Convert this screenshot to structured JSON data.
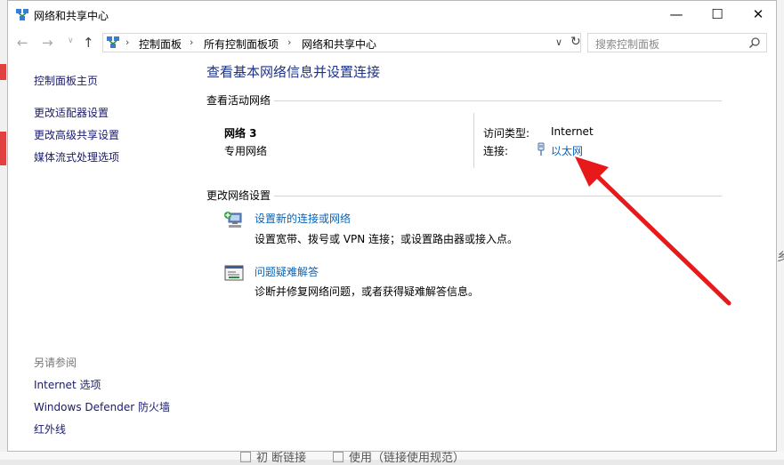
{
  "window": {
    "title": "网络和共享中心",
    "controls": {
      "minimize": "—",
      "maximize": "☐",
      "close": "✕"
    }
  },
  "navigation": {
    "back": "←",
    "forward": "→",
    "recent": "∨",
    "up": "↑",
    "breadcrumb": [
      "控制面板",
      "所有控制面板项",
      "网络和共享中心"
    ],
    "dropdown": "∨",
    "refresh": "↻"
  },
  "search": {
    "placeholder": "搜索控制面板"
  },
  "sidebar": {
    "home": "控制面板主页",
    "links": [
      "更改适配器设置",
      "更改高级共享设置",
      "媒体流式处理选项"
    ],
    "see_also_title": "另请参阅",
    "see_also": [
      "Internet 选项",
      "Windows Defender 防火墙",
      "红外线"
    ]
  },
  "main": {
    "title": "查看基本网络信息并设置连接",
    "active_section": "查看活动网络",
    "network": {
      "name": "网络 3",
      "type": "专用网络"
    },
    "access_type_label": "访问类型:",
    "access_type_value": "Internet",
    "connection_label": "连接:",
    "connection_value": "以太网",
    "change_section": "更改网络设置",
    "tasks": [
      {
        "title": "设置新的连接或网络",
        "desc": "设置宽带、拨号或 VPN 连接；或设置路由器或接入点。",
        "icon": "new-connection-icon"
      },
      {
        "title": "问题疑难解答",
        "desc": "诊断并修复网络问题，或者获得疑难解答信息。",
        "icon": "troubleshoot-icon"
      }
    ]
  },
  "background": {
    "right_glyph": "乡",
    "bottom_left": "初 断链接",
    "bottom_right": "使用（链接使用规范）"
  },
  "colors": {
    "link": "#0b63b5",
    "title": "#1e3287",
    "annotation_arrow": "#e8191a"
  }
}
